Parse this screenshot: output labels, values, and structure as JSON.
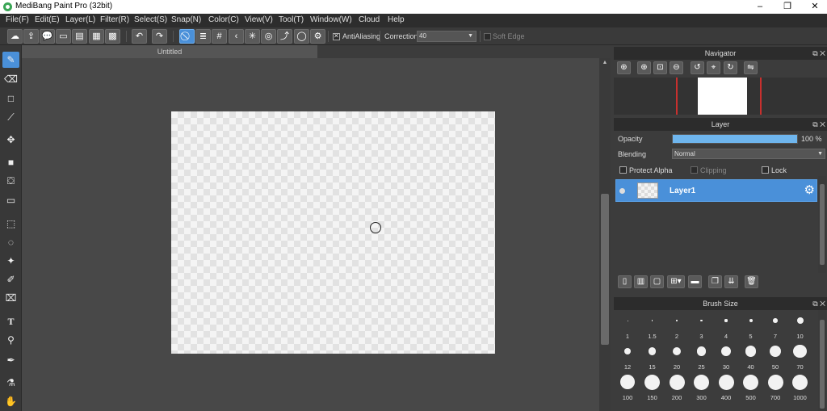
{
  "window": {
    "title": "MediBang Paint Pro (32bit)",
    "controls": [
      "minimize",
      "maximize",
      "close"
    ]
  },
  "menu": [
    {
      "label": "File(F)"
    },
    {
      "label": "Edit(E)"
    },
    {
      "label": "Layer(L)"
    },
    {
      "label": "Filter(R)"
    },
    {
      "label": "Select(S)"
    },
    {
      "label": "Snap(N)"
    },
    {
      "label": "Color(C)"
    },
    {
      "label": "View(V)"
    },
    {
      "label": "Tool(T)"
    },
    {
      "label": "Window(W)"
    },
    {
      "label": "Cloud"
    },
    {
      "label": "Help"
    }
  ],
  "toolbar": {
    "antialiasing_label": "AntiAliasing",
    "antialiasing_checked": true,
    "correction_label": "Correction",
    "correction_value": "40",
    "soft_edge_label": "Soft Edge",
    "soft_edge_checked": false
  },
  "document": {
    "tab_title": "Untitled"
  },
  "navigator": {
    "title": "Navigator"
  },
  "layer_panel": {
    "title": "Layer",
    "opacity_label": "Opacity",
    "opacity_value": "100 %",
    "opacity": 1.0,
    "blending_label": "Blending",
    "blending_value": "Normal",
    "protect_alpha_label": "Protect Alpha",
    "clipping_label": "Clipping",
    "lock_label": "Lock",
    "layers": [
      {
        "name": "Layer1",
        "selected": true,
        "visible": true
      }
    ]
  },
  "brush_size": {
    "title": "Brush Size",
    "sizes": [
      "1",
      "1.5",
      "2",
      "3",
      "4",
      "5",
      "7",
      "10",
      "12",
      "15",
      "20",
      "25",
      "30",
      "40",
      "50",
      "70",
      "100",
      "150",
      "200",
      "300",
      "400",
      "500",
      "700",
      "1000"
    ]
  },
  "colors": {
    "accent": "#4a90d9",
    "opacity_bar": "#6fb6ee",
    "navigator_frame": "#c8302e",
    "app_icon": "#3aa555"
  }
}
